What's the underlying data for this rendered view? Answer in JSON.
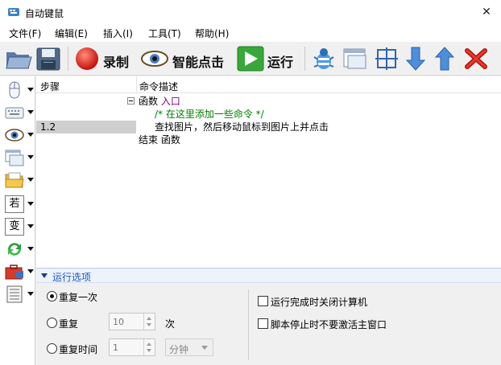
{
  "window": {
    "title": "自动键鼠",
    "close_glyph": "✕"
  },
  "menu": [
    "文件(F)",
    "编辑(E)",
    "插入(I)",
    "工具(T)",
    "帮助(H)"
  ],
  "toolbar": {
    "record_label": "录制",
    "smart_click_label": "智能点击",
    "run_label": "运行"
  },
  "sidebar": {
    "if_label": "若",
    "var_label": "变"
  },
  "table": {
    "headers": {
      "step": "步骤",
      "desc": "命令描述"
    },
    "rows": [
      {
        "step": "",
        "kw": "函数",
        "name": "入口"
      },
      {
        "step": "",
        "comment": "/* 在这里添加一些命令 */"
      },
      {
        "step": "1.2",
        "text": "查找图片，然后移动鼠标到图片上并点击"
      },
      {
        "step": "",
        "kw": "结束",
        "name": "函数"
      }
    ]
  },
  "options": {
    "title": "运行选项",
    "once_label": "重复一次",
    "repeat_label": "重复",
    "repeat_value": "10",
    "repeat_unit": "次",
    "repeat_time_label": "重复时间",
    "repeat_time_value": "1",
    "time_unit": "分钟",
    "shutdown_label": "运行完成时关闭计算机",
    "no_activate_label": "脚本停止时不要激活主窗口"
  }
}
